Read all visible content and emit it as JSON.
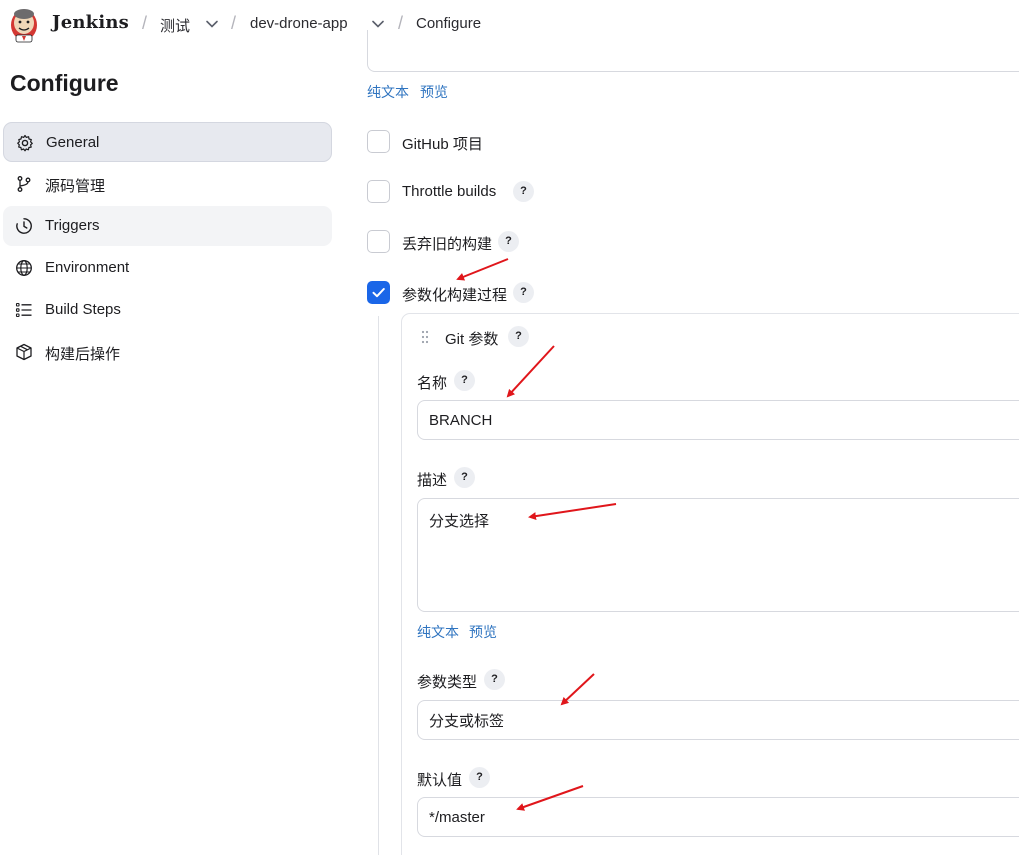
{
  "header": {
    "brand": "Jenkins",
    "breadcrumbs": [
      {
        "label": "测试",
        "has_menu": true
      },
      {
        "label": "dev-drone-app",
        "has_menu": true
      },
      {
        "label": "Configure",
        "has_menu": false
      }
    ]
  },
  "sidebar": {
    "title": "Configure",
    "items": [
      {
        "label": "General",
        "icon": "gear-icon",
        "state": "active"
      },
      {
        "label": "源码管理",
        "icon": "branch-icon",
        "state": "normal"
      },
      {
        "label": "Triggers",
        "icon": "clock-icon",
        "state": "hover"
      },
      {
        "label": "Environment",
        "icon": "globe-icon",
        "state": "normal"
      },
      {
        "label": "Build Steps",
        "icon": "list-icon",
        "state": "normal"
      },
      {
        "label": "构建后操作",
        "icon": "package-icon",
        "state": "normal"
      }
    ]
  },
  "main": {
    "description_links": {
      "plain": "纯文本",
      "preview": "预览"
    },
    "options": [
      {
        "label": "GitHub 项目",
        "checked": false,
        "has_help": false
      },
      {
        "label": "Throttle builds",
        "checked": false,
        "has_help": true
      },
      {
        "label": "丢弃旧的构建",
        "checked": false,
        "has_help": true
      },
      {
        "label": "参数化构建过程",
        "checked": true,
        "has_help": true
      }
    ],
    "parameter": {
      "title": "Git 参数",
      "name_label": "名称",
      "name_value": "BRANCH",
      "desc_label": "描述",
      "desc_value": "分支选择",
      "desc_links": {
        "plain": "纯文本",
        "preview": "预览"
      },
      "type_label": "参数类型",
      "type_value": "分支或标签",
      "default_label": "默认值",
      "default_value": "*/master"
    },
    "help_glyph": "?"
  },
  "colors": {
    "accent": "#1a66e8",
    "link": "#2f74c0",
    "annotation_arrow": "#e0161b",
    "active_nav": "#e7e9ef"
  }
}
